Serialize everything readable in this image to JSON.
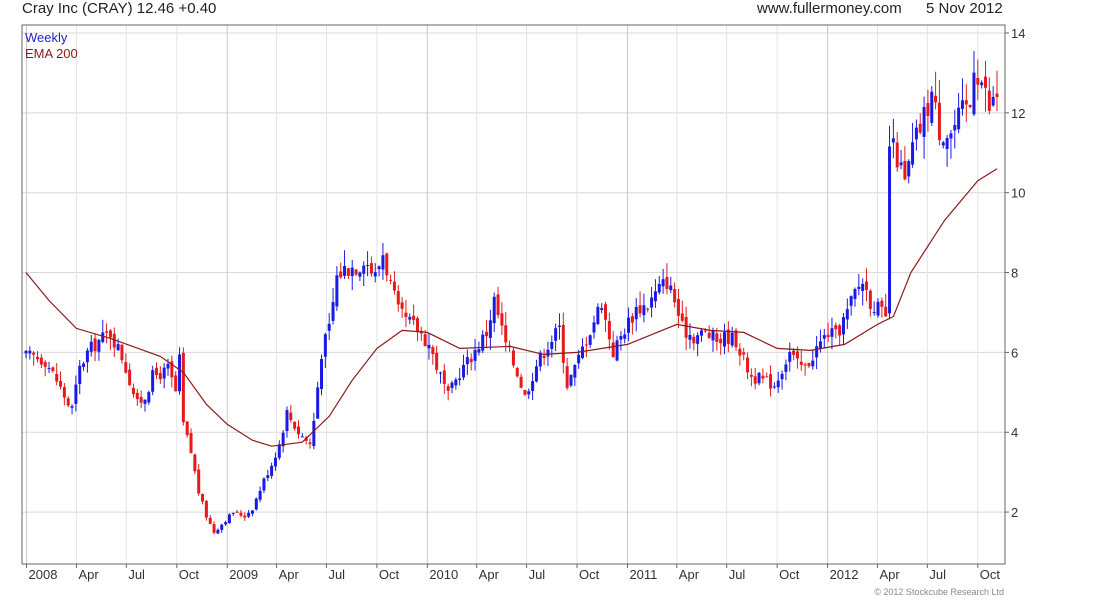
{
  "header": {
    "title": "Cray Inc (CRAY) 12.46 +0.40",
    "website": "www.fullermoney.com",
    "date": "5 Nov 2012"
  },
  "legend": {
    "interval": "Weekly",
    "interval_color": "#2222cc",
    "ema": "EMA 200",
    "ema_color": "#8b1a1a"
  },
  "copyright": "© 2012 Stockcube Research Ltd",
  "colors": {
    "up": "#1a1ae6",
    "down": "#e61a1a",
    "ema": "#8b1a1a",
    "grid": "#d8d8d8"
  },
  "chart_data": {
    "type": "candlestick",
    "title": "Cray Inc (CRAY) 12.46 +0.40",
    "interval": "Weekly",
    "x_range": [
      "2007-12-31",
      "2012-11-05"
    ],
    "ylim": [
      0.7,
      14.2
    ],
    "y_ticks": [
      2,
      4,
      6,
      8,
      10,
      12,
      14
    ],
    "x_ticks": [
      {
        "date": "2008-01-01",
        "label": "2008",
        "major": true
      },
      {
        "date": "2008-04-01",
        "label": "Apr"
      },
      {
        "date": "2008-07-01",
        "label": "Jul"
      },
      {
        "date": "2008-10-01",
        "label": "Oct"
      },
      {
        "date": "2009-01-01",
        "label": "2009",
        "major": true
      },
      {
        "date": "2009-04-01",
        "label": "Apr"
      },
      {
        "date": "2009-07-01",
        "label": "Jul"
      },
      {
        "date": "2009-10-01",
        "label": "Oct"
      },
      {
        "date": "2010-01-01",
        "label": "2010",
        "major": true
      },
      {
        "date": "2010-04-01",
        "label": "Apr"
      },
      {
        "date": "2010-07-01",
        "label": "Jul"
      },
      {
        "date": "2010-10-01",
        "label": "Oct"
      },
      {
        "date": "2011-01-01",
        "label": "2011",
        "major": true
      },
      {
        "date": "2011-04-01",
        "label": "Apr"
      },
      {
        "date": "2011-07-01",
        "label": "Jul"
      },
      {
        "date": "2011-10-01",
        "label": "Oct"
      },
      {
        "date": "2012-01-01",
        "label": "2012",
        "major": true
      },
      {
        "date": "2012-04-01",
        "label": "Apr"
      },
      {
        "date": "2012-07-01",
        "label": "Jul"
      },
      {
        "date": "2012-10-01",
        "label": "Oct"
      }
    ],
    "grid": true,
    "legend_position": "top-left",
    "price_close_path": [
      [
        "2007-12-31",
        5.9
      ],
      [
        "2008-01-14",
        5.9
      ],
      [
        "2008-02-04",
        5.8
      ],
      [
        "2008-02-25",
        5.3
      ],
      [
        "2008-03-17",
        4.7
      ],
      [
        "2008-03-24",
        4.6
      ],
      [
        "2008-04-07",
        5.6
      ],
      [
        "2008-04-21",
        6.0
      ],
      [
        "2008-05-12",
        6.3
      ],
      [
        "2008-06-02",
        6.5
      ],
      [
        "2008-06-23",
        5.9
      ],
      [
        "2008-07-07",
        5.3
      ],
      [
        "2008-07-21",
        4.7
      ],
      [
        "2008-08-04",
        4.9
      ],
      [
        "2008-08-18",
        5.4
      ],
      [
        "2008-09-08",
        5.5
      ],
      [
        "2008-09-15",
        5.6
      ],
      [
        "2008-09-29",
        5.0
      ],
      [
        "2008-10-06",
        5.8
      ],
      [
        "2008-10-13",
        4.2
      ],
      [
        "2008-10-27",
        3.5
      ],
      [
        "2008-11-10",
        2.5
      ],
      [
        "2008-11-24",
        1.9
      ],
      [
        "2008-12-08",
        1.5
      ],
      [
        "2008-12-29",
        1.8
      ],
      [
        "2009-01-12",
        2.0
      ],
      [
        "2009-02-02",
        1.9
      ],
      [
        "2009-02-16",
        2.1
      ],
      [
        "2009-03-09",
        2.8
      ],
      [
        "2009-03-23",
        3.2
      ],
      [
        "2009-04-06",
        3.7
      ],
      [
        "2009-04-20",
        4.5
      ],
      [
        "2009-05-11",
        4.0
      ],
      [
        "2009-06-01",
        3.7
      ],
      [
        "2009-06-08",
        4.3
      ],
      [
        "2009-06-22",
        6.0
      ],
      [
        "2009-07-06",
        6.6
      ],
      [
        "2009-07-20",
        7.9
      ],
      [
        "2009-08-03",
        8.1
      ],
      [
        "2009-08-31",
        8.2
      ],
      [
        "2009-09-07",
        8.4
      ],
      [
        "2009-09-28",
        7.9
      ],
      [
        "2009-10-12",
        8.5
      ],
      [
        "2009-10-26",
        7.7
      ],
      [
        "2009-11-09",
        7.0
      ],
      [
        "2009-11-23",
        6.8
      ],
      [
        "2009-12-14",
        6.6
      ],
      [
        "2010-01-04",
        6.2
      ],
      [
        "2010-01-25",
        5.4
      ],
      [
        "2010-02-08",
        4.9
      ],
      [
        "2010-03-01",
        5.5
      ],
      [
        "2010-03-22",
        5.9
      ],
      [
        "2010-04-05",
        6.2
      ],
      [
        "2010-04-19",
        6.5
      ],
      [
        "2010-05-03",
        7.3
      ],
      [
        "2010-05-24",
        6.2
      ],
      [
        "2010-06-14",
        5.5
      ],
      [
        "2010-06-28",
        4.9
      ],
      [
        "2010-07-19",
        5.7
      ],
      [
        "2010-08-09",
        6.2
      ],
      [
        "2010-08-30",
        6.6
      ],
      [
        "2010-09-13",
        5.2
      ],
      [
        "2010-09-27",
        5.6
      ],
      [
        "2010-10-11",
        6.1
      ],
      [
        "2010-11-01",
        6.8
      ],
      [
        "2010-11-15",
        7.3
      ],
      [
        "2010-11-22",
        6.8
      ],
      [
        "2010-12-06",
        6.0
      ],
      [
        "2010-12-27",
        6.6
      ],
      [
        "2011-01-17",
        7.1
      ],
      [
        "2011-02-07",
        7.2
      ],
      [
        "2011-02-28",
        7.6
      ],
      [
        "2011-03-14",
        7.8
      ],
      [
        "2011-03-28",
        7.3
      ],
      [
        "2011-04-11",
        6.6
      ],
      [
        "2011-05-02",
        6.4
      ],
      [
        "2011-05-23",
        6.5
      ],
      [
        "2011-06-13",
        6.3
      ],
      [
        "2011-07-04",
        6.4
      ],
      [
        "2011-07-18",
        6.3
      ],
      [
        "2011-08-01",
        5.8
      ],
      [
        "2011-08-15",
        5.4
      ],
      [
        "2011-09-05",
        5.3
      ],
      [
        "2011-09-26",
        5.2
      ],
      [
        "2011-10-10",
        5.6
      ],
      [
        "2011-10-24",
        6.0
      ],
      [
        "2011-11-07",
        5.7
      ],
      [
        "2011-11-21",
        5.6
      ],
      [
        "2011-12-12",
        6.1
      ],
      [
        "2012-01-02",
        6.5
      ],
      [
        "2012-01-16",
        6.4
      ],
      [
        "2012-02-06",
        7.0
      ],
      [
        "2012-02-20",
        7.5
      ],
      [
        "2012-03-05",
        7.8
      ],
      [
        "2012-03-19",
        7.3
      ],
      [
        "2012-04-02",
        7.1
      ],
      [
        "2012-04-16",
        6.8
      ],
      [
        "2012-04-23",
        11.2
      ],
      [
        "2012-05-07",
        10.9
      ],
      [
        "2012-05-21",
        10.2
      ],
      [
        "2012-06-04",
        11.1
      ],
      [
        "2012-06-25",
        11.9
      ],
      [
        "2012-07-09",
        12.5
      ],
      [
        "2012-07-23",
        11.6
      ],
      [
        "2012-08-13",
        11.5
      ],
      [
        "2012-09-03",
        12.0
      ],
      [
        "2012-09-17",
        12.2
      ],
      [
        "2012-09-24",
        13.3
      ],
      [
        "2012-10-08",
        12.8
      ],
      [
        "2012-10-22",
        12.1
      ],
      [
        "2012-11-05",
        12.46
      ]
    ],
    "ema_200": [
      [
        "2007-12-31",
        8.0
      ],
      [
        "2008-02-11",
        7.3
      ],
      [
        "2008-04-01",
        6.6
      ],
      [
        "2008-06-02",
        6.35
      ],
      [
        "2008-09-01",
        5.9
      ],
      [
        "2008-10-13",
        5.5
      ],
      [
        "2008-11-24",
        4.7
      ],
      [
        "2009-01-01",
        4.2
      ],
      [
        "2009-02-16",
        3.8
      ],
      [
        "2009-03-23",
        3.65
      ],
      [
        "2009-05-18",
        3.75
      ],
      [
        "2009-07-06",
        4.4
      ],
      [
        "2009-08-17",
        5.3
      ],
      [
        "2009-10-01",
        6.1
      ],
      [
        "2009-11-16",
        6.55
      ],
      [
        "2010-01-01",
        6.5
      ],
      [
        "2010-03-01",
        6.1
      ],
      [
        "2010-06-01",
        6.15
      ],
      [
        "2010-08-01",
        5.95
      ],
      [
        "2010-10-01",
        6.0
      ],
      [
        "2011-01-01",
        6.2
      ],
      [
        "2011-04-01",
        6.7
      ],
      [
        "2011-06-01",
        6.55
      ],
      [
        "2011-08-01",
        6.5
      ],
      [
        "2011-10-01",
        6.1
      ],
      [
        "2011-12-01",
        6.05
      ],
      [
        "2012-02-01",
        6.2
      ],
      [
        "2012-04-01",
        6.7
      ],
      [
        "2012-04-30",
        6.9
      ],
      [
        "2012-06-01",
        8.0
      ],
      [
        "2012-08-01",
        9.3
      ],
      [
        "2012-10-01",
        10.3
      ],
      [
        "2012-11-05",
        10.6
      ]
    ]
  }
}
